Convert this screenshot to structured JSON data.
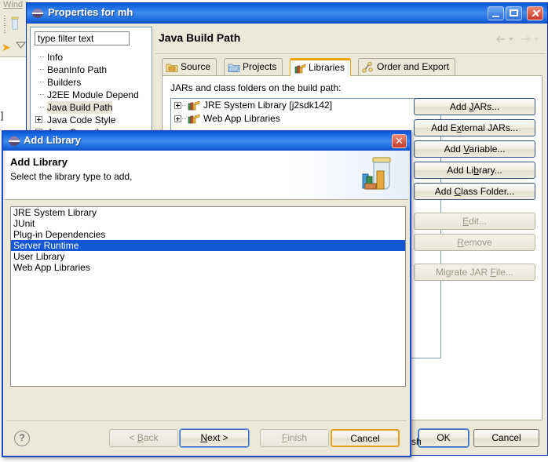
{
  "ide_background": {
    "menu_window": "Wind",
    "editor_fragment": "]",
    "toolbar_jar_icon": "jar-icon",
    "toolbar_arrow_icon": "yellow-arrow-icon"
  },
  "properties_window": {
    "title": "Properties for mh",
    "title_icon": "eclipse-globe-icon",
    "minimize_label": "_",
    "maximize_label": "□",
    "close_label": "✕",
    "filter": {
      "value": "type filter text",
      "placeholder": "type filter text"
    },
    "tree_items": [
      {
        "label": "Info",
        "expandable": false,
        "selected": false
      },
      {
        "label": "BeanInfo Path",
        "expandable": false,
        "selected": false
      },
      {
        "label": "Builders",
        "expandable": false,
        "selected": false
      },
      {
        "label": "J2EE Module Depend",
        "expandable": false,
        "selected": false
      },
      {
        "label": "Java Build Path",
        "expandable": false,
        "selected": true
      },
      {
        "label": "Java Code Style",
        "expandable": true,
        "selected": false
      },
      {
        "label": "Java Compiler",
        "expandable": true,
        "selected": false
      }
    ],
    "page_title": "Java Build Path",
    "nav_back_icon": "back-arrow-icon",
    "nav_forward_icon": "forward-arrow-icon",
    "tabs": [
      {
        "label": "Source",
        "icon": "source-folder-icon",
        "active": false
      },
      {
        "label": "Projects",
        "icon": "projects-folder-icon",
        "active": false
      },
      {
        "label": "Libraries",
        "icon": "libraries-books-icon",
        "active": true
      },
      {
        "label": "Order and Export",
        "icon": "order-export-icon",
        "active": false
      }
    ],
    "panel_label": "JARs and class folders on the build path:",
    "panel_label_mnemonic": "a",
    "jar_entries": [
      {
        "label": "JRE System Library [j2sdk142]",
        "icon": "library-books-icon"
      },
      {
        "label": "Web App Libraries",
        "icon": "library-books-icon"
      }
    ],
    "side_buttons": [
      {
        "label": "Add JARs...",
        "mnemonic": "J",
        "enabled": true
      },
      {
        "label": "Add External JARs...",
        "mnemonic": "x",
        "enabled": true
      },
      {
        "label": "Add Variable...",
        "mnemonic": "V",
        "enabled": true
      },
      {
        "label": "Add Library...",
        "mnemonic": "b",
        "enabled": true
      },
      {
        "label": "Add Class Folder...",
        "mnemonic": "C",
        "enabled": true
      },
      {
        "label": "Edit...",
        "mnemonic": "E",
        "enabled": false
      },
      {
        "label": "Remove",
        "mnemonic": "R",
        "enabled": false
      },
      {
        "label": "Migrate JAR File...",
        "mnemonic": "F",
        "enabled": false
      }
    ],
    "ok_label": "OK",
    "cancel_label": "Cancel"
  },
  "add_library_dialog": {
    "title": "Add Library",
    "title_icon": "eclipse-globe-icon",
    "close_label": "✕",
    "heading": "Add Library",
    "subheading": "Select the library type to add,",
    "header_icon": "jar-with-books-icon",
    "library_types": [
      {
        "label": "JRE System Library",
        "selected": false
      },
      {
        "label": "JUnit",
        "selected": false
      },
      {
        "label": "Plug-in Dependencies",
        "selected": false
      },
      {
        "label": "Server Runtime",
        "selected": true
      },
      {
        "label": "User Library",
        "selected": false
      },
      {
        "label": "Web App Libraries",
        "selected": false
      }
    ],
    "help_label": "?",
    "buttons": [
      {
        "id": "back",
        "label": "< Back",
        "mnemonic": "B",
        "enabled": false,
        "focused": false
      },
      {
        "id": "next",
        "label": "Next >",
        "mnemonic": "N",
        "enabled": true,
        "focused": true
      },
      {
        "id": "finish",
        "label": "Finish",
        "mnemonic": "F",
        "enabled": false,
        "focused": false
      },
      {
        "id": "cancel",
        "label": "Cancel",
        "mnemonic": "",
        "enabled": true,
        "focused": false
      }
    ]
  },
  "behind_fragment": "sh",
  "colors": {
    "titlebar_blue": "#1464e0",
    "dialog_border": "#1b4fc8",
    "selection_blue": "#1457d6",
    "tab_accent_orange": "#f0a30a",
    "cancel_focus_orange": "#e3a21a",
    "face": "#ece9d8",
    "disabled_text": "#9c9884"
  }
}
